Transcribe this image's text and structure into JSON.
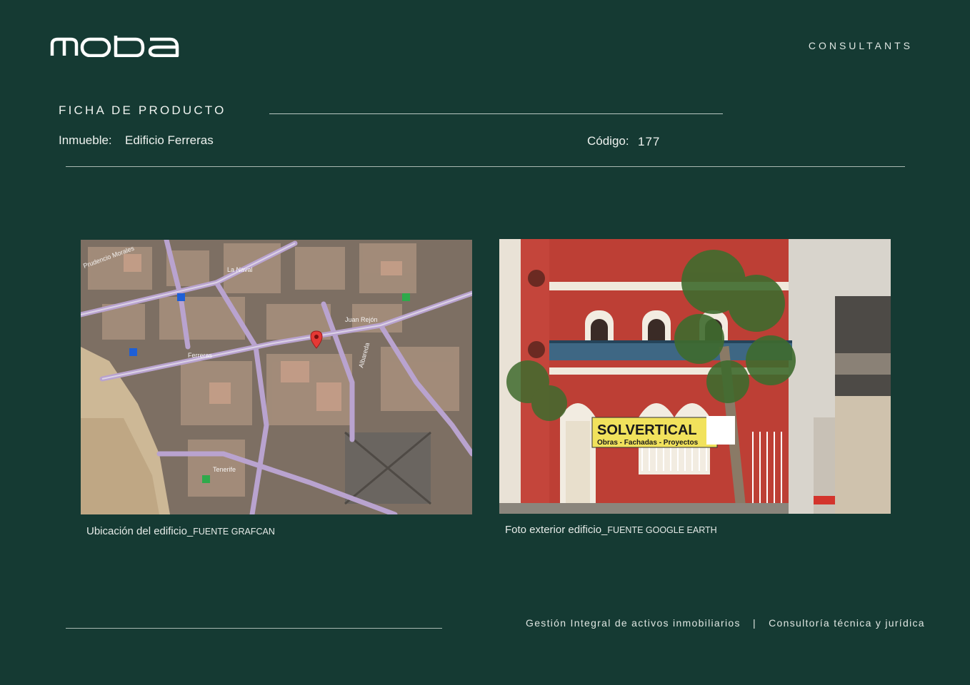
{
  "header": {
    "logo_text": "moba",
    "tagline": "CONSULTANTS"
  },
  "product_sheet": {
    "title": "FICHA DE PRODUCTO",
    "property_label": "Inmueble:",
    "property_value": "Edificio Ferreras",
    "code_label": "Código:",
    "code_value": "177"
  },
  "images": [
    {
      "caption": "Ubicación del edificio_",
      "source": "FUENTE GRAFCAN",
      "map_labels": [
        "La Naval",
        "Juan Rejón",
        "Ferreras",
        "Albareda",
        "Tenerife",
        "Prudencio Morales"
      ]
    },
    {
      "caption": "Foto exterior edificio_",
      "source": "FUENTE GOOGLE EARTH",
      "sign_title": "SOLVERTICAL",
      "sign_subtitle": "Obras - Fachadas - Proyectos"
    }
  ],
  "footer": {
    "left": "Gestión Integral de activos inmobiliarios",
    "separator": "|",
    "right": "Consultoría técnica y jurídica"
  },
  "colors": {
    "background": "#153a33",
    "text": "#e8ece9"
  }
}
